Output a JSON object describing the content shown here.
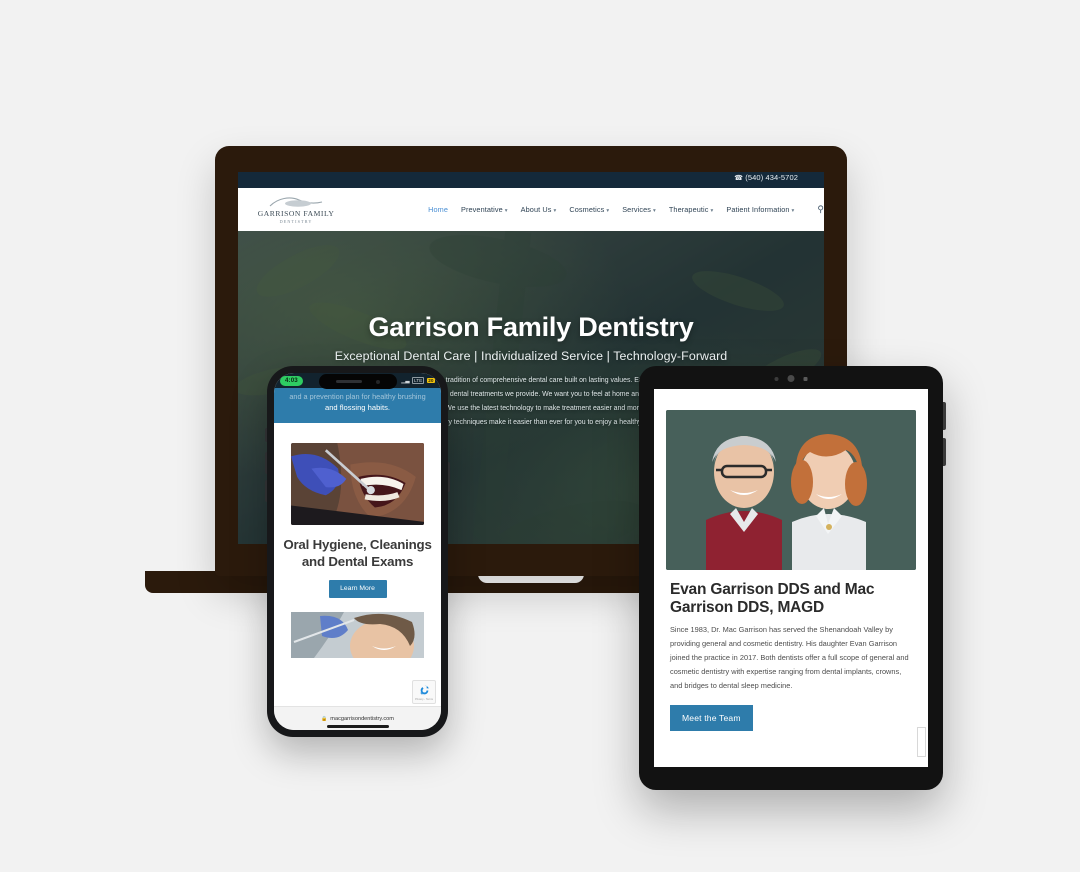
{
  "scene": {
    "background_color": "#f2f2f2",
    "devices": [
      "laptop",
      "phone",
      "tablet"
    ]
  },
  "website": {
    "brand": {
      "logo_line1": "GARRISON FAMILY",
      "logo_line2": "DENTISTRY",
      "accent_color": "#2e7cab",
      "header_bar_color": "#14293a"
    },
    "topbar": {
      "phone_icon": "phone-icon",
      "phone_number": "(540) 434-5702"
    },
    "nav": {
      "items": [
        {
          "label": "Home",
          "has_dropdown": false,
          "active": true
        },
        {
          "label": "Preventative",
          "has_dropdown": true,
          "active": false
        },
        {
          "label": "About Us",
          "has_dropdown": true,
          "active": false
        },
        {
          "label": "Cosmetics",
          "has_dropdown": true,
          "active": false
        },
        {
          "label": "Services",
          "has_dropdown": true,
          "active": false
        },
        {
          "label": "Therapeutic",
          "has_dropdown": true,
          "active": false
        },
        {
          "label": "Patient Information",
          "has_dropdown": true,
          "active": false
        }
      ],
      "search_icon": "search-icon",
      "caret_glyph": "⌄"
    },
    "hero": {
      "title": "Garrison Family Dentistry",
      "subtitle": "Exceptional Dental Care | Individualized Service | Technology-Forward",
      "paragraph": "We've established a tradition of comprehensive dental care built on lasting values. Each patient is unique and so are the dental treatments we provide. We want you to feel at home and comfortable during your visit. We use the latest technology to make treatment easier and more precise. Modern dentistry techniques make it easier than ever for you to enjoy a healthy smile.",
      "scroll_icon": "chevron-down-icon"
    }
  },
  "tablet": {
    "camera_icons": [
      "sensor-dot-icon",
      "camera-lens-icon",
      "flash-dot-icon"
    ],
    "page": {
      "photo_alt": "two-dentists-portrait",
      "heading": "Evan Garrison DDS and Mac Garrison DDS, MAGD",
      "body": "Since 1983, Dr. Mac Garrison has served the Shenandoah Valley by providing general and cosmetic dentistry. His daughter Evan Garrison joined the practice in 2017. Both dentists offer a full scope of general and cosmetic dentistry with expertise ranging from dental implants, crowns, and bridges to dental sleep medicine.",
      "button_label": "Meet the Team",
      "button_color": "#2e7cab"
    }
  },
  "phone": {
    "status_bar": {
      "time": "4:03",
      "time_pill_color": "#2ecc62",
      "signal_icon": "signal-bars-icon",
      "network_label": "LTE",
      "battery_label": "20",
      "battery_color": "#f2c40d",
      "speaker_icon": "earpiece-speaker-icon",
      "front_camera_icon": "front-camera-icon"
    },
    "page": {
      "banner_text_faded": "and a prevention plan for healthy brushing",
      "banner_text": "and flossing habits.",
      "banner_color": "#2e7cab",
      "photo_alt": "dental-exam-blue-gloves",
      "card_title": "Oral Hygiene, Cleanings and Dental Exams",
      "button_label": "Learn More",
      "second_photo_alt": "smiling-patient-dental-chair",
      "recaptcha_icon": "recaptcha-badge-icon",
      "recaptcha_label": "Privacy - Terms"
    },
    "browser": {
      "lock_icon": "lock-icon",
      "url": "macgarrisondentistry.com",
      "home_indicator": "home-indicator"
    }
  }
}
